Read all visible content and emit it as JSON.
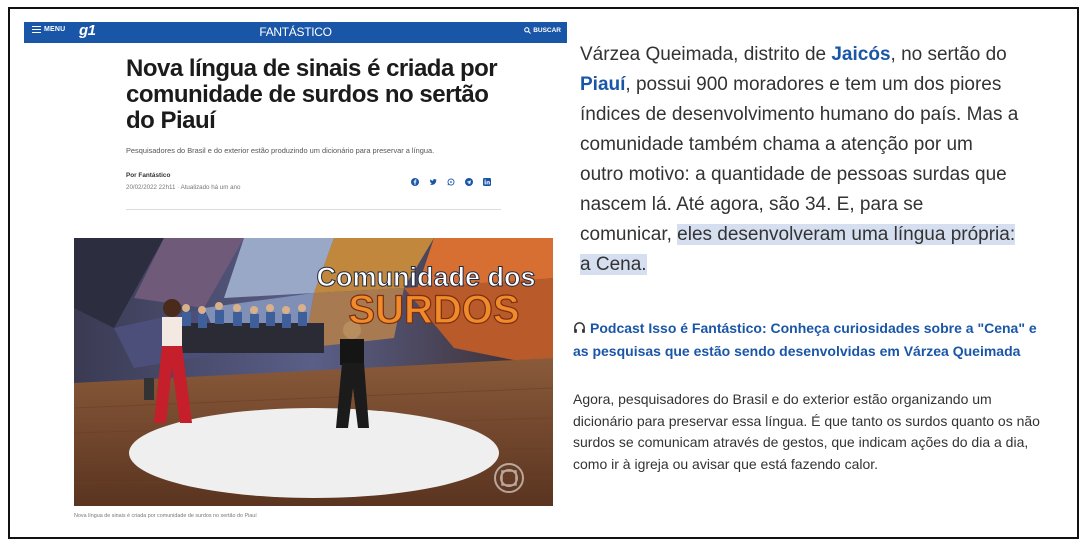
{
  "topbar": {
    "menu_label": "MENU",
    "logo": "g1",
    "program": "FANTÁSTICO",
    "search_label": "BUSCAR",
    "color": "#1a56a8"
  },
  "article": {
    "headline": "Nova língua de sinais é criada por comunidade de surdos no sertão do Piauí",
    "subtitle": "Pesquisadores do Brasil e do exterior estão produzindo um dicionário para preservar a língua.",
    "byline": "Por Fantástico",
    "dateline": "20/02/2022 22h11 · Atualizado há um ano",
    "share_icons": [
      "facebook-icon",
      "twitter-icon",
      "whatsapp-icon",
      "telegram-icon",
      "linkedin-icon"
    ],
    "photo": {
      "title_line1": "Comunidade dos",
      "title_line2": "SURDOS"
    },
    "caption": "Nova língua de sinais é criada por comunidade de surdos no sertão do Piauí"
  },
  "right": {
    "p1_a": "Várzea Queimada, distrito de ",
    "p1_link1": "Jaicós",
    "p1_b": ", no sertão do ",
    "p1_link2": "Piauí",
    "p1_c": ", possui 900 moradores e tem um dos piores índices de desenvolvimento humano do país. Mas a comunidade também chama a atenção por um outro motivo: a quantidade de pessoas surdas que nascem lá. Até agora, são 34. E, para se comunicar, ",
    "p1_highlight": "eles desenvolveram uma língua própria: a Cena.",
    "podcast_link": "Podcast Isso é Fantástico: Conheça curiosidades sobre a \"Cena\" e as pesquisas que estão sendo desenvolvidas em Várzea Queimada",
    "p2": "Agora, pesquisadores do Brasil e do exterior estão organizando um dicionário para preservar essa língua. É que tanto os surdos quanto os não surdos se comunicam através de gestos, que indicam ações do dia a dia, como ir à igreja ou avisar que está fazendo calor."
  },
  "colors": {
    "brand_blue": "#1a56a8",
    "highlight": "#d5dff0"
  }
}
